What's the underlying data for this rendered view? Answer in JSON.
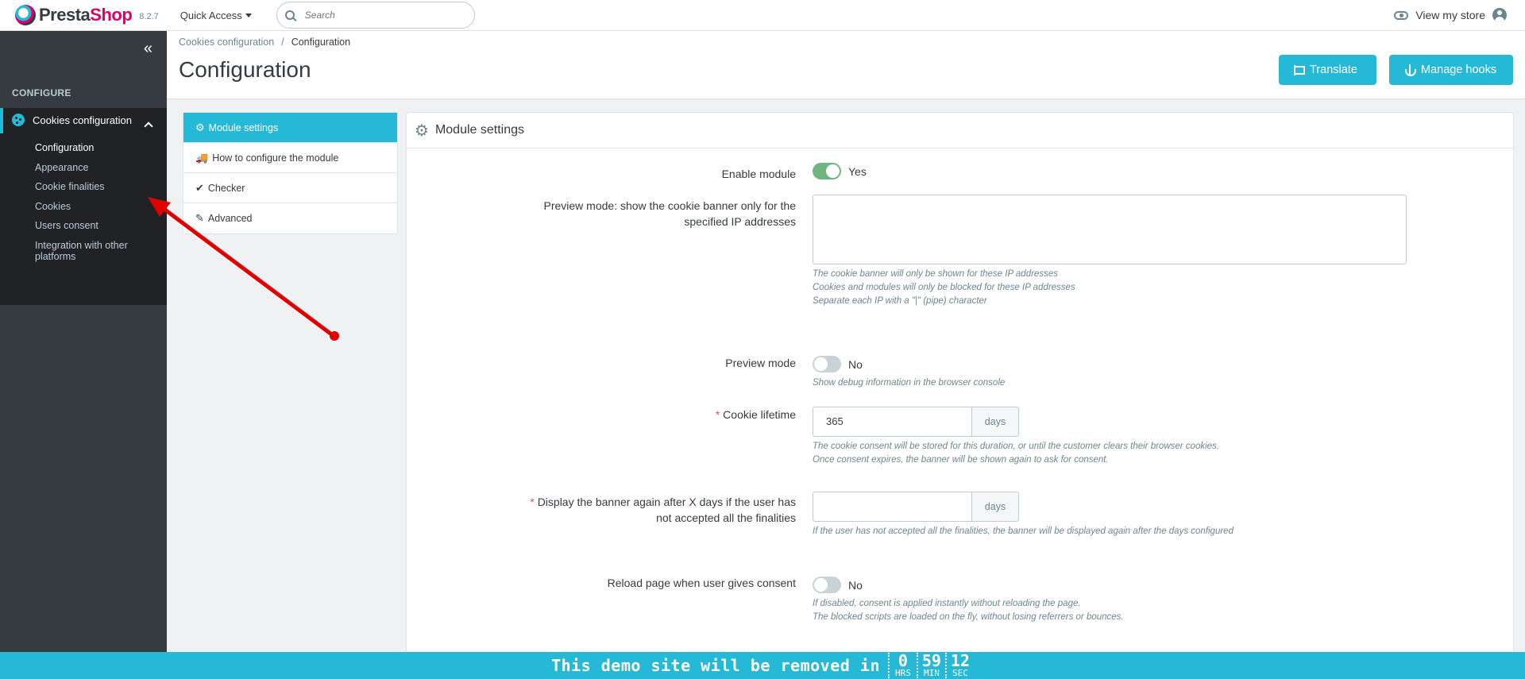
{
  "header": {
    "logo_presta": "Presta",
    "logo_shop": "Shop",
    "version": "8.2.7",
    "quick_access": "Quick Access",
    "search_placeholder": "Search",
    "view_store": "View my store"
  },
  "sidebar": {
    "section": "CONFIGURE",
    "active_item": "Cookies configuration",
    "sub_items": [
      "Configuration",
      "Appearance",
      "Cookie finalities",
      "Cookies",
      "Users consent",
      "Integration with other platforms"
    ]
  },
  "page": {
    "breadcrumb": [
      "Cookies configuration",
      "/",
      "Configuration"
    ],
    "title": "Configuration",
    "buttons": {
      "translate": "Translate",
      "manage_hooks": "Manage hooks"
    }
  },
  "tabs": [
    "Module settings",
    "How to configure the module",
    "Checker",
    "Advanced"
  ],
  "panel": {
    "title": "Module settings",
    "fields": {
      "enable_module": {
        "label": "Enable module",
        "value": "Yes"
      },
      "preview_ips": {
        "label": "Preview mode: show the cookie banner only for the specified IP addresses",
        "help": [
          "The cookie banner will only be shown for these IP addresses",
          "Cookies and modules will only be blocked for these IP addresses",
          "Separate each IP with a \"|\" (pipe) character"
        ]
      },
      "preview_mode": {
        "label": "Preview mode",
        "value": "No",
        "help": "Show debug information in the browser console"
      },
      "cookie_lifetime": {
        "required": "*",
        "label": "Cookie lifetime",
        "value": "365",
        "unit": "days",
        "help": [
          "The cookie consent will be stored for this duration, or until the customer clears their browser cookies.",
          "Once consent expires, the banner will be shown again to ask for consent."
        ]
      },
      "display_again": {
        "required": "*",
        "label": "Display the banner again after X days if the user has not accepted all the finalities",
        "value": "",
        "unit": "days",
        "help": "If the user has not accepted all the finalities, the banner will be displayed again after the days configured"
      },
      "reload_page": {
        "label": "Reload page when user gives consent",
        "value": "No",
        "help": [
          "If disabled, consent is applied instantly without reloading the page.",
          "The blocked scripts are loaded on the fly, without losing referrers or bounces."
        ]
      }
    }
  },
  "demo_bar": {
    "text": "This demo site will be removed in",
    "countdown": [
      {
        "value": "0",
        "unit": "HRS"
      },
      {
        "value": "59",
        "unit": "MIN"
      },
      {
        "value": "12",
        "unit": "SEC"
      }
    ]
  },
  "colors": {
    "primary": "#25b9d7",
    "sidebar": "#363a41",
    "toggle_on": "#70b580",
    "arrow": "#e00000"
  }
}
